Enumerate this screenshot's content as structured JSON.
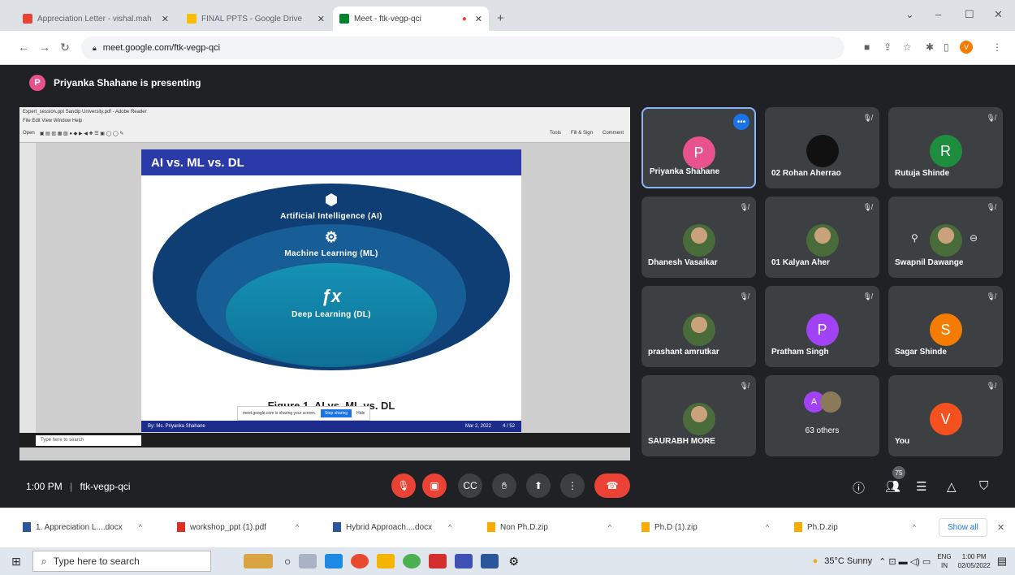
{
  "browser": {
    "tabs": [
      {
        "label": "Appreciation Letter - vishal.mah",
        "color": "#ea4335"
      },
      {
        "label": "FINAL PPTS - Google Drive",
        "color": "#fbbc04"
      },
      {
        "label": "Meet - ftk-vegp-qci",
        "color": "#00832d"
      }
    ],
    "url": "meet.google.com/ftk-vegp-qci"
  },
  "meet": {
    "presenter_initial": "P",
    "presenting_text": "Priyanka Shahane is presenting",
    "meeting_time": "1:00 PM",
    "meeting_code": "ftk-vegp-qci",
    "participant_count": "75"
  },
  "presentation": {
    "window_title": "Expert_session.ppt Sandip University.pdf - Adobe Reader",
    "menu": "File  Edit  View  Window  Help",
    "toolbar_left": "Open",
    "toolbar_tools": [
      "Tools",
      "Fill & Sign",
      "Comment"
    ],
    "slide_title": "AI vs. ML vs. DL",
    "layers": [
      {
        "icon": "brain-icon",
        "label": "Artificial Intelligence (AI)",
        "color": "#0f3e74"
      },
      {
        "icon": "gear-icon",
        "label": "Machine Learning (ML)",
        "color": "#175d96"
      },
      {
        "icon": "function-icon",
        "label": "Deep Learning (DL)",
        "color": "#1592b5"
      }
    ],
    "caption": "Figure 1. AI vs. ML vs. DL",
    "footer_left": "By: Ms. Priyanka Shahane",
    "footer_date": "Mar 2, 2022",
    "footer_page": "4 / 52",
    "share_notice": "meet.google.com is sharing your screen.",
    "stop_sharing": "Stop sharing",
    "hide": "Hide",
    "inner_search": "Type here to search"
  },
  "participants": [
    {
      "name": "Priyanka Shahane",
      "initial": "P",
      "color": "#e8528d",
      "type": "letter",
      "speaking": true
    },
    {
      "name": "02 Rohan Aherrao",
      "initial": "",
      "color": "#111111",
      "type": "logo"
    },
    {
      "name": "Rutuja Shinde",
      "initial": "R",
      "color": "#1e8e3e",
      "type": "letter"
    },
    {
      "name": "Dhanesh Vasaikar",
      "initial": "",
      "color": "#6b5a3a",
      "type": "photo"
    },
    {
      "name": "01 Kalyan Aher",
      "initial": "",
      "color": "#8a7a5a",
      "type": "photo"
    },
    {
      "name": "Swapnil Dawange",
      "initial": "",
      "color": "#3a5a7a",
      "type": "photo"
    },
    {
      "name": "prashant amrutkar",
      "initial": "",
      "color": "#5a6a3a",
      "type": "photo"
    },
    {
      "name": "Pratham Singh",
      "initial": "P",
      "color": "#a142f4",
      "type": "letter"
    },
    {
      "name": "Sagar Shinde",
      "initial": "S",
      "color": "#f57c00",
      "type": "letter"
    },
    {
      "name": "SAURABH MORE",
      "initial": "",
      "color": "#c0392b",
      "type": "photo"
    },
    {
      "name": "63 others",
      "initial": "A",
      "color": "#a142f4",
      "type": "others"
    },
    {
      "name": "You",
      "initial": "V",
      "color": "#f4511e",
      "type": "letter"
    }
  ],
  "downloads": [
    {
      "label": "1. Appreciation L....docx",
      "color": "#2b579a"
    },
    {
      "label": "workshop_ppt (1).pdf",
      "color": "#d93025"
    },
    {
      "label": "Hybrid Approach....docx",
      "color": "#2b579a"
    },
    {
      "label": "Non Ph.D.zip",
      "color": "#f9ab00"
    },
    {
      "label": "Ph.D (1).zip",
      "color": "#f9ab00"
    },
    {
      "label": "Ph.D.zip",
      "color": "#f9ab00"
    }
  ],
  "show_all": "Show all",
  "taskbar": {
    "search_placeholder": "Type here to search",
    "weather": "35°C  Sunny",
    "lang_top": "ENG",
    "lang_bottom": "IN",
    "time": "1:00 PM",
    "date": "02/05/2022"
  }
}
